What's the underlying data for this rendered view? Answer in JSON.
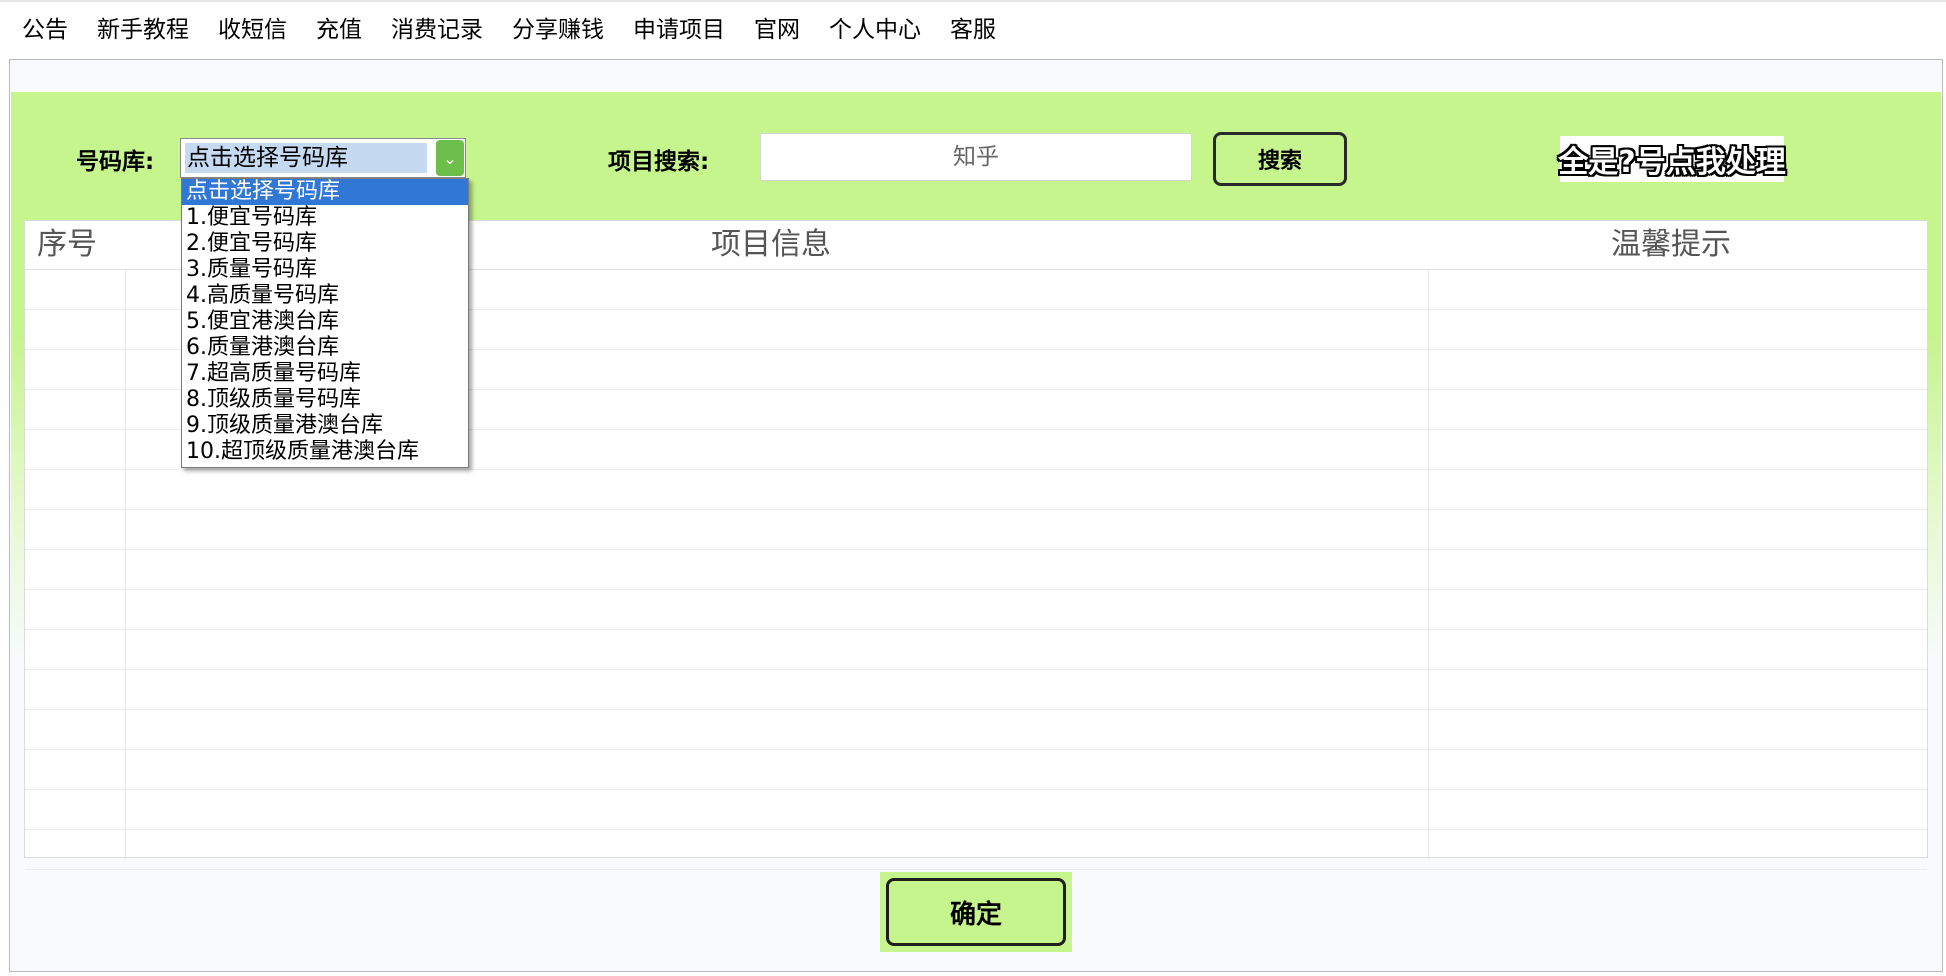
{
  "menu": [
    "公告",
    "新手教程",
    "收短信",
    "充值",
    "消费记录",
    "分享赚钱",
    "申请项目",
    "官网",
    "个人中心",
    "客服"
  ],
  "pool": {
    "label": "号码库:",
    "selected": "点击选择号码库",
    "options": [
      "点击选择号码库",
      "1.便宜号码库",
      "2.便宜号码库",
      "3.质量号码库",
      "4.高质量号码库",
      "5.便宜港澳台库",
      "6.质量港澳台库",
      "7.超高质量号码库",
      "8.顶级质量号码库",
      "9.顶级质量港澳台库",
      "10.超顶级质量港澳台库"
    ]
  },
  "search": {
    "label": "项目搜索:",
    "value": "知乎",
    "button": "搜索"
  },
  "question_link": "全是?号点我处理",
  "table": {
    "headers": {
      "seq": "序号",
      "info": "项目信息",
      "tip": "温馨提示"
    },
    "row_count": 15
  },
  "confirm": "确定",
  "colors": {
    "accent_green": "#c6f48d",
    "select_highlight": "#3177d6"
  }
}
